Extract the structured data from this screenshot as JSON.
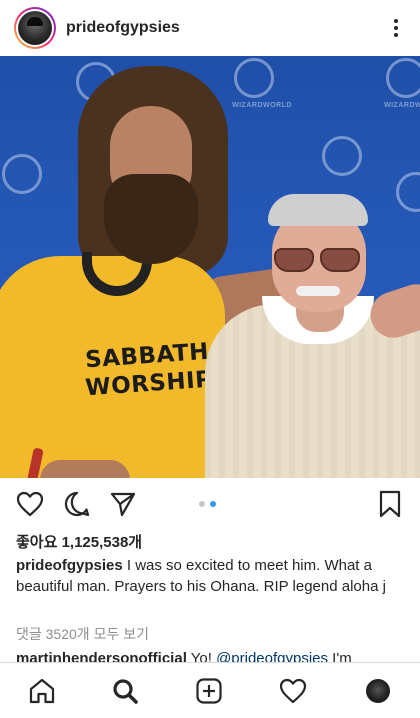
{
  "post": {
    "username": "prideofgypsies",
    "likes_text": "좋아요 1,125,538개",
    "caption_username": "prideofgypsies",
    "caption_text": " I was so excited to meet him.  What a beautiful man. Prayers to his Ohana.  RIP legend aloha j",
    "view_comments": "댓글 3520개 모두 보기",
    "first_comment": {
      "username": "martinhendersonofficial",
      "text_before_mention": " Yo! ",
      "mention": "@prideofgypsies",
      "text_after_mention": " I'm"
    },
    "photo": {
      "shirt_line1": "SABBATH",
      "shirt_line2": "WORSHIP",
      "banner_text": "WIZARDWORLD"
    },
    "carousel": {
      "count": 2,
      "active_index": 1,
      "active_color": "#3897f0",
      "inactive_color": "#c7c7c7"
    }
  },
  "icons": {
    "header": [
      "more-options-icon"
    ],
    "actions": [
      "heart-icon",
      "comment-icon",
      "share-icon",
      "bookmark-icon"
    ],
    "nav": [
      "home-icon",
      "search-icon",
      "new-post-icon",
      "activity-icon",
      "profile-icon"
    ]
  },
  "colors": {
    "text": "#262626",
    "secondary_text": "#8e8e8e",
    "link": "#00376b",
    "divider": "#dbdbdb"
  }
}
